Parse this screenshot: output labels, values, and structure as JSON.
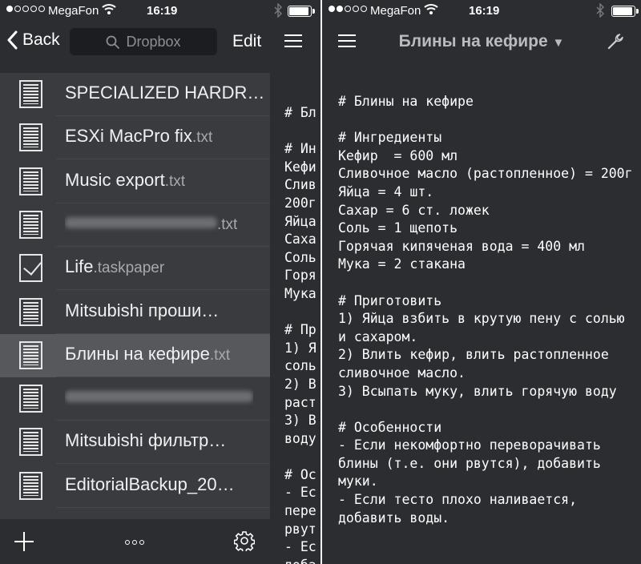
{
  "status_bar": {
    "carrier": "MegaFon",
    "time": "16:19"
  },
  "left": {
    "nav": {
      "back_label": "Back",
      "search_placeholder": "Dropbox",
      "edit_label": "Edit"
    },
    "files": [
      {
        "name": "SPECIALIZED HARDR…",
        "ext": "",
        "icon": "document-icon",
        "blurred": false,
        "selected": false
      },
      {
        "name": "ESXi MacPro fix",
        "ext": ".txt",
        "icon": "document-icon",
        "blurred": false,
        "selected": false
      },
      {
        "name": "Music export",
        "ext": ".txt",
        "icon": "document-icon",
        "blurred": false,
        "selected": false
      },
      {
        "name": "",
        "ext": ".txt",
        "icon": "document-icon",
        "blurred": true,
        "selected": false
      },
      {
        "name": "Life",
        "ext": ".taskpaper",
        "icon": "checkbox-icon",
        "blurred": false,
        "selected": false
      },
      {
        "name": "Mitsubishi проши…",
        "ext": "",
        "icon": "document-icon",
        "blurred": false,
        "selected": false
      },
      {
        "name": "Блины на кефире",
        "ext": ".txt",
        "icon": "document-icon",
        "blurred": false,
        "selected": true
      },
      {
        "name": "",
        "ext": "",
        "icon": "document-icon",
        "blurred": true,
        "selected": false
      },
      {
        "name": "Mitsubishi фильтр…",
        "ext": "",
        "icon": "document-icon",
        "blurred": false,
        "selected": false
      },
      {
        "name": "EditorialBackup_20…",
        "ext": "",
        "icon": "document-icon",
        "blurred": false,
        "selected": false
      }
    ],
    "peek_text": "# Бл\n\n# Ин\nКефи\nСлив\n200г\nЯйца\nСаха\nСоль\nГоря\nМука\n\n# Пр\n1) Я\nсоль\n2) В\nраст\n3) В\nводу\n\n# Ос\n- Ес\nпере\nрвут\n- Ес\nдоба"
  },
  "right": {
    "title": "Блины на кефире",
    "document": "# Блины на кефире\n\n# Ингредиенты\nКефир  = 600 мл\nСливочное масло (растопленное) = 200г\nЯйца = 4 шт.\nСахар = 6 ст. ложек\nСоль = 1 щепоть\nГорячая кипяченая вода = 400 мл\nМука = 2 стакана\n\n# Приготовить\n1) Яйца взбить в крутую пену с солью и сахаром.\n2) Влить кефир, влить растопленное сливочное масло.\n3) Всыпать муку, влить горячую воду\n\n# Особенности\n- Если некомфортно переворачивать блины (т.е. они рвутся), добавить муки.\n- Если тесто плохо наливается, добавить воды."
  }
}
